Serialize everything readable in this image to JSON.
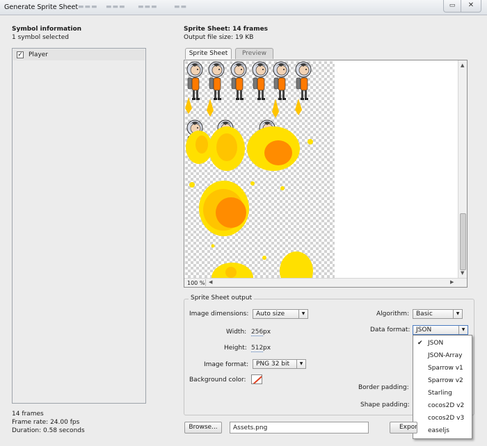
{
  "window": {
    "title": "Generate Sprite Sheet"
  },
  "symbol_panel": {
    "heading": "Symbol information",
    "selected_count": "1 symbol selected",
    "symbols": [
      {
        "name": "Player",
        "checked": true
      }
    ],
    "frames": "14 frames",
    "frame_rate": "Frame rate: 24.00 fps",
    "duration": "Duration: 0.58 seconds"
  },
  "sheet": {
    "heading": "Sprite Sheet: 14 frames",
    "file_size": "Output file size: 19 KB",
    "tabs": [
      "Sprite Sheet",
      "Preview"
    ],
    "active_tab": "Sprite Sheet",
    "zoom": "100 %"
  },
  "output": {
    "legend": "Sprite Sheet output",
    "image_dimensions_label": "Image dimensions:",
    "image_dimensions_value": "Auto size",
    "width_label": "Width:",
    "width_value": "256",
    "height_label": "Height:",
    "height_value": "512",
    "unit": "px",
    "image_format_label": "Image format:",
    "image_format_value": "PNG 32 bit",
    "background_color_label": "Background color:",
    "algorithm_label": "Algorithm:",
    "algorithm_value": "Basic",
    "data_format_label": "Data format:",
    "data_format_value": "JSON",
    "border_padding_label": "Border padding:",
    "shape_padding_label": "Shape padding:"
  },
  "data_format_menu": {
    "options": [
      "JSON",
      "JSON-Array",
      "Sparrow v1",
      "Sparrow v2",
      "Starling",
      "cocos2D v2",
      "cocos2D v3",
      "easeljs"
    ],
    "selected": "JSON"
  },
  "footer": {
    "browse_label": "Browse...",
    "file_name": "Assets.png",
    "export_label": "Export"
  },
  "colors": {
    "flame_yellow": "#ffe000",
    "flame_orange": "#ff8c00",
    "flame_gold": "#ffc400",
    "accent_underline": "#4a7abf"
  }
}
